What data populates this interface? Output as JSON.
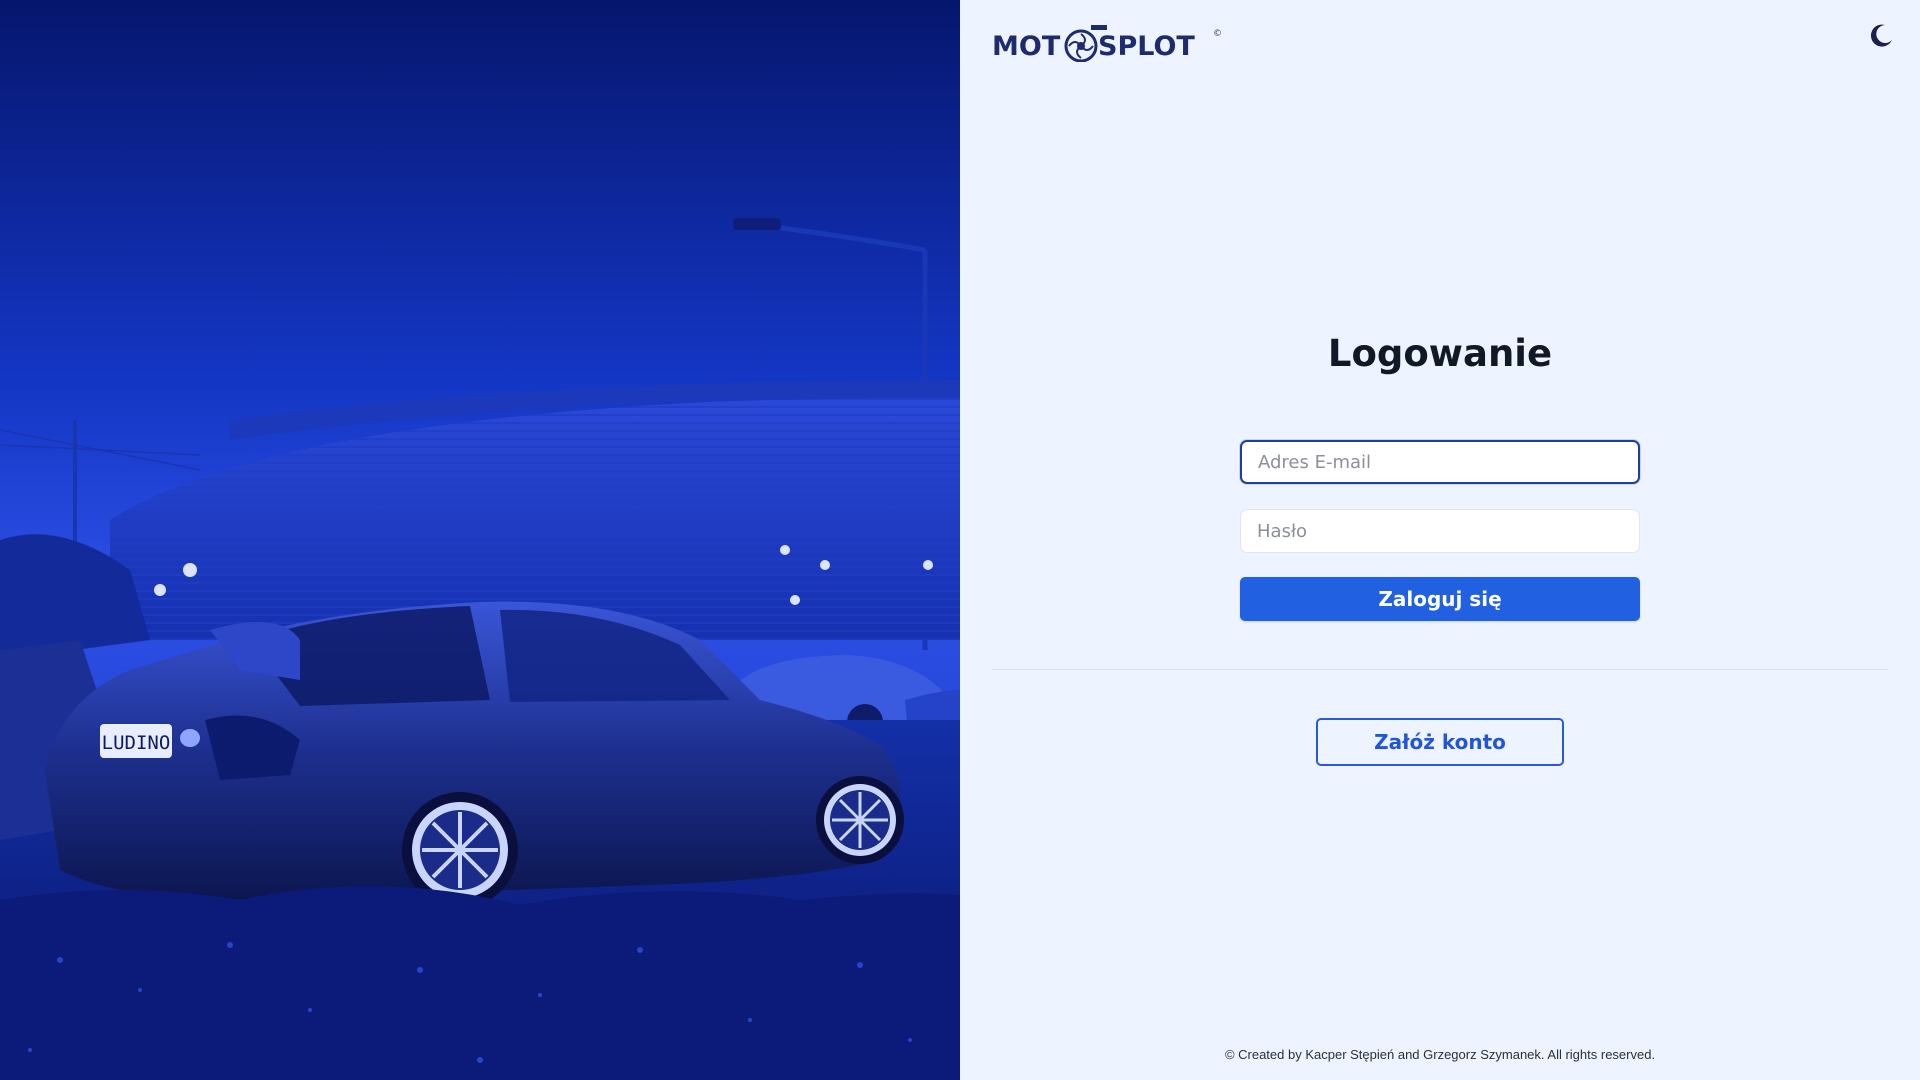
{
  "brand": {
    "logo_text_left": "MOT",
    "logo_text_right": "SPLOT",
    "logo_mark": "©",
    "accent": "#2160e0",
    "logo_color": "#1e2c6e"
  },
  "theme_toggle": {
    "icon": "moon-icon"
  },
  "login": {
    "title": "Logowanie",
    "email_placeholder": "Adres E-mail",
    "email_value": "",
    "password_placeholder": "Hasło",
    "password_value": "",
    "submit_label": "Zaloguj się"
  },
  "register": {
    "label": "Załóż konto"
  },
  "hero": {
    "plate": "LUDINO",
    "image": "lexus-sedan-photo"
  },
  "footer": {
    "text": "© Created by Kacper Stępień and Grzegorz Szymanek. All rights reserved."
  }
}
